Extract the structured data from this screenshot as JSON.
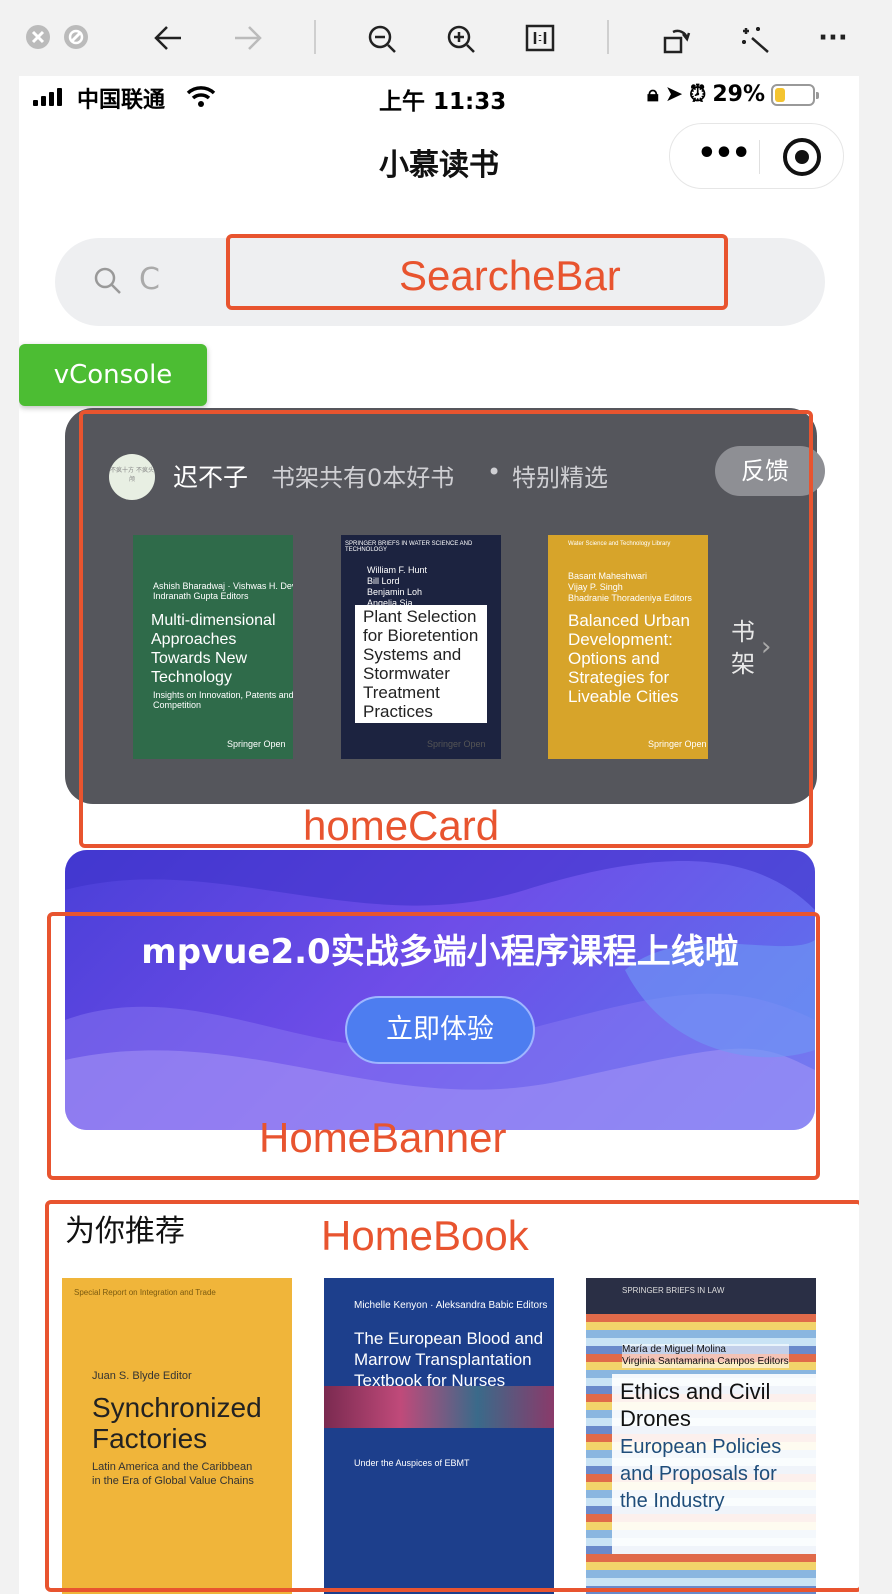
{
  "devtools": {
    "icons": [
      "close-circle-icon",
      "stop-circle-icon",
      "back-arrow-icon",
      "forward-arrow-icon",
      "zoom-out-icon",
      "zoom-in-icon",
      "actual-size-icon",
      "rotate-icon",
      "magic-wand-icon",
      "more-icon"
    ]
  },
  "status_bar": {
    "carrier": "中国联通",
    "time": "上午 11:33",
    "battery_percent": "29%",
    "battery_level": 0.29
  },
  "navbar": {
    "title": "小慕读书"
  },
  "search": {
    "placeholder": "C"
  },
  "vconsole": {
    "label": "vConsole"
  },
  "home_card": {
    "username": "迟不子",
    "avatar_text": "不疯十方 不疯头颅",
    "shelf_info": "书架共有0本好书",
    "dot": "•",
    "selection": "特别精选",
    "feedback": "反馈",
    "shelf_link": "书架",
    "books": [
      {
        "series": "",
        "authors": "Ashish Bharadwaj · Vishwas H. Devaiah\nIndranath Gupta Editors",
        "title": "Multi-dimensional\nApproaches\nTowards New\nTechnology",
        "subtitle": "Insights on Innovation, Patents and\nCompetition",
        "publisher": "Springer Open",
        "color": "#2f6b4a"
      },
      {
        "series": "SPRINGER BRIEFS IN WATER SCIENCE AND TECHNOLOGY",
        "authors": "William F. Hunt\nBill Lord\nBenjamin Loh\nAngelia Sia",
        "title": "Plant Selection\nfor Bioretention\nSystems and\nStormwater\nTreatment\nPractices",
        "subtitle": "",
        "publisher": "Springer Open",
        "color": "#1c2340"
      },
      {
        "series": "Water Science and Technology Library",
        "authors": "Basant Maheshwari\nVijay P. Singh\nBhadranie Thoradeniya Editors",
        "title": "Balanced Urban\nDevelopment:\nOptions and\nStrategies for\nLiveable Cities",
        "subtitle": "",
        "publisher": "Springer Open",
        "color": "#d7a42a"
      }
    ]
  },
  "home_banner": {
    "title": "mpvue2.0实战多端小程序课程上线啦",
    "button": "立即体验"
  },
  "home_book": {
    "title": "为你推荐",
    "books": [
      {
        "series": "Special Report on Integration and Trade",
        "authors": "Juan S. Blyde Editor",
        "title": "Synchronized\nFactories",
        "subtitle": "Latin America and the Caribbean\nin the Era of Global Value Chains",
        "color": "#f0b53a"
      },
      {
        "series": "",
        "authors": "Michelle Kenyon · Aleksandra Babic Editors",
        "title": "The European Blood and\nMarrow Transplantation\nTextbook for Nurses",
        "subtitle": "Under the Auspices of EBMT",
        "color": "#1d3f8c"
      },
      {
        "series": "SPRINGER BRIEFS IN LAW",
        "authors": "María de Miguel Molina\nVirginia Santamarina Campos Editors",
        "title": "Ethics and Civil\nDrones",
        "subtitle": "European Policies\nand Proposals for\nthe Industry",
        "color": "#2a2f45"
      }
    ]
  },
  "annotations": {
    "search": "SearcheBar",
    "card": "homeCard",
    "banner": "HomeBanner",
    "book": "HomeBook",
    "color": "#e8542f"
  }
}
